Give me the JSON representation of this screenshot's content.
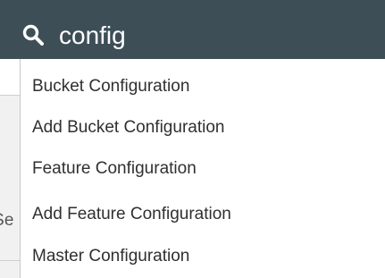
{
  "search": {
    "query": "config",
    "icon": "search-icon"
  },
  "background_hint_text": "Se",
  "dropdown": {
    "items": [
      {
        "label": "Bucket Configuration"
      },
      {
        "label": "Add Bucket Configuration"
      },
      {
        "label": "Feature Configuration"
      },
      {
        "label": "Add Feature Configuration"
      },
      {
        "label": "Master Configuration"
      }
    ]
  },
  "colors": {
    "search_bar_bg": "#3e4e57",
    "search_text": "#ffffff",
    "item_text": "#303030"
  }
}
